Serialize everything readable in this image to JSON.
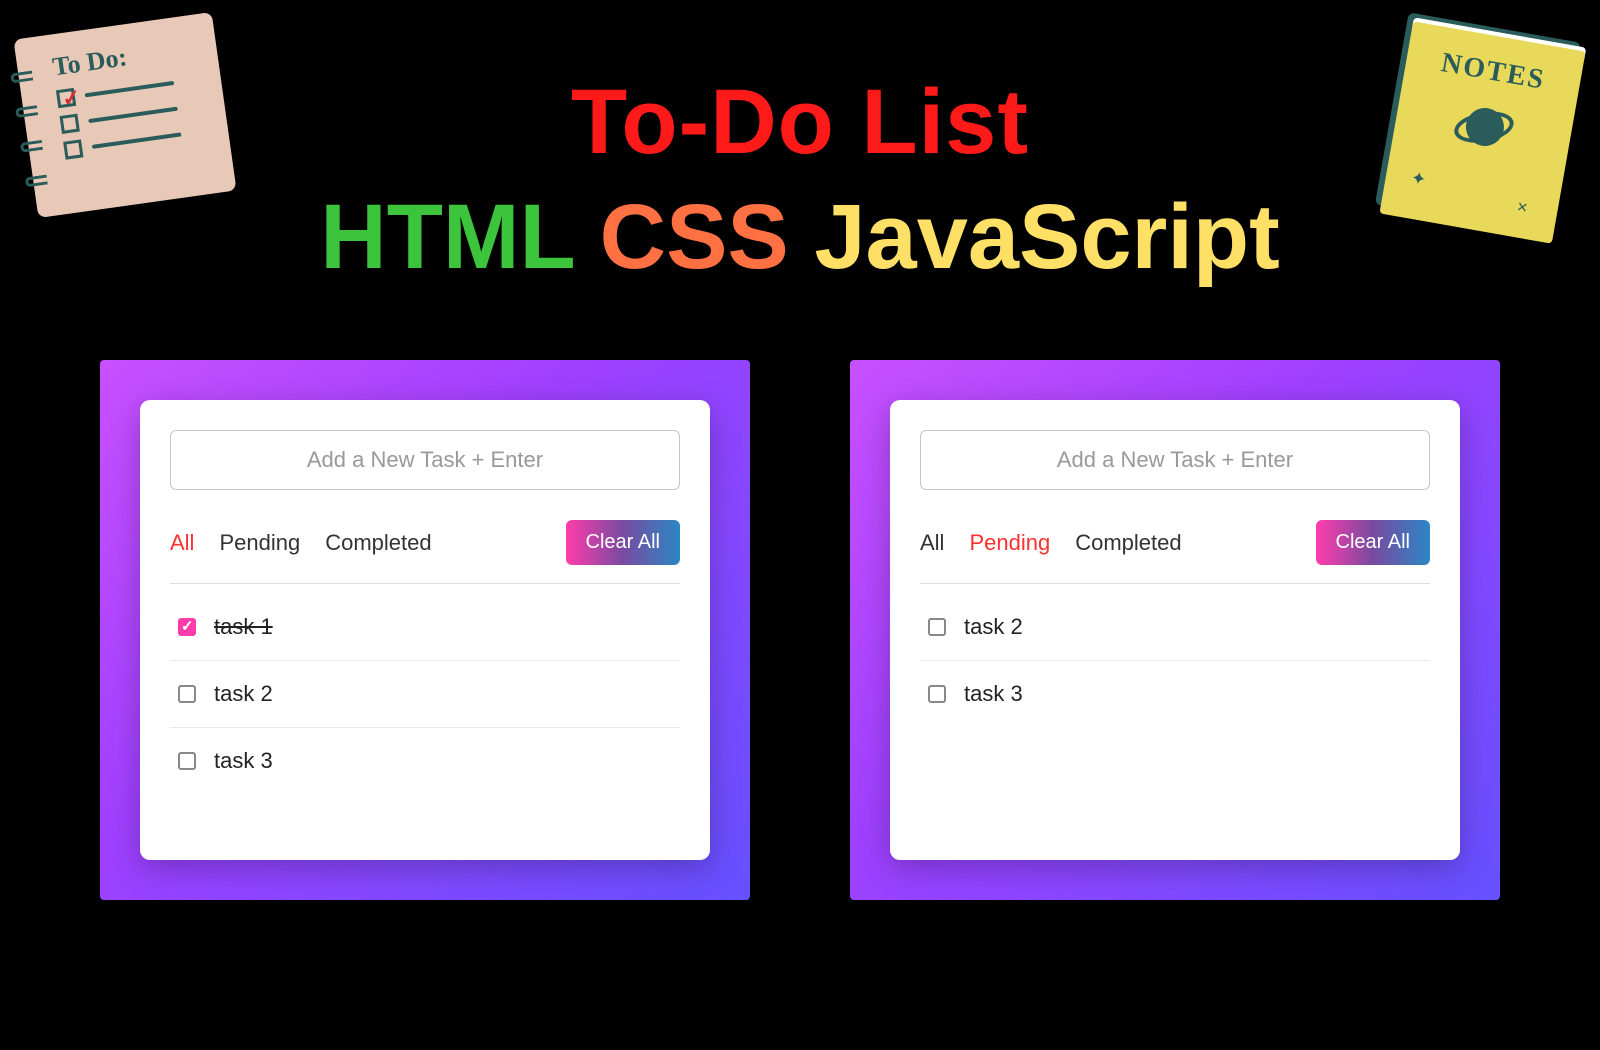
{
  "decorations": {
    "todo_label": "To Do:",
    "notes_label": "NOTES"
  },
  "headline": {
    "title": "To-Do List",
    "sub_html": "HTML",
    "sub_css": "CSS",
    "sub_js": "JavaScript"
  },
  "panel_left": {
    "placeholder": "Add a New Task + Enter",
    "filters": {
      "all": "All",
      "pending": "Pending",
      "completed": "Completed"
    },
    "active_filter": "all",
    "clear_label": "Clear All",
    "tasks": [
      {
        "label": "task 1",
        "checked": true
      },
      {
        "label": "task 2",
        "checked": false
      },
      {
        "label": "task 3",
        "checked": false
      }
    ]
  },
  "panel_right": {
    "placeholder": "Add a New Task + Enter",
    "filters": {
      "all": "All",
      "pending": "Pending",
      "completed": "Completed"
    },
    "active_filter": "pending",
    "clear_label": "Clear All",
    "tasks": [
      {
        "label": "task 2",
        "checked": false
      },
      {
        "label": "task 3",
        "checked": false
      }
    ]
  }
}
